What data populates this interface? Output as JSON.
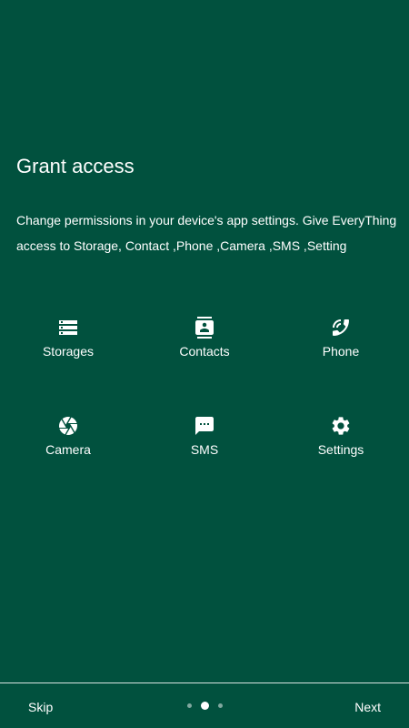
{
  "header": {
    "title": "Grant access",
    "description": "Change permissions in your device's app settings. Give EveryThing access to Storage, Contact ,Phone ,Camera ,SMS ,Setting"
  },
  "permissions": [
    {
      "label": "Storages",
      "icon": "storage-icon"
    },
    {
      "label": "Contacts",
      "icon": "contacts-icon"
    },
    {
      "label": "Phone",
      "icon": "phone-icon"
    },
    {
      "label": "Camera",
      "icon": "camera-icon"
    },
    {
      "label": "SMS",
      "icon": "sms-icon"
    },
    {
      "label": "Settings",
      "icon": "settings-icon"
    }
  ],
  "footer": {
    "skip_label": "Skip",
    "next_label": "Next",
    "page_count": 3,
    "current_page": 2
  },
  "colors": {
    "background": "#01513e",
    "foreground": "#ffffff"
  }
}
